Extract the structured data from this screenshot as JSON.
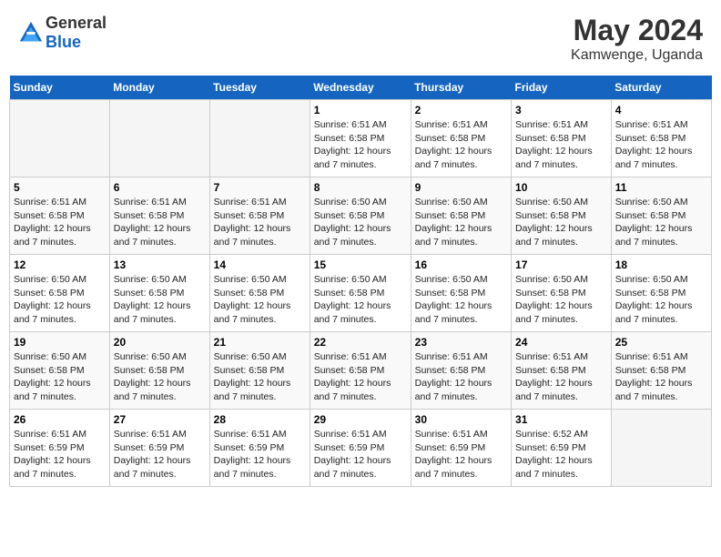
{
  "header": {
    "logo_general": "General",
    "logo_blue": "Blue",
    "month_title": "May 2024",
    "location": "Kamwenge, Uganda"
  },
  "weekdays": [
    "Sunday",
    "Monday",
    "Tuesday",
    "Wednesday",
    "Thursday",
    "Friday",
    "Saturday"
  ],
  "weeks": [
    [
      {
        "day": "",
        "sunrise": "",
        "sunset": "",
        "daylight": ""
      },
      {
        "day": "",
        "sunrise": "",
        "sunset": "",
        "daylight": ""
      },
      {
        "day": "",
        "sunrise": "",
        "sunset": "",
        "daylight": ""
      },
      {
        "day": "1",
        "sunrise": "Sunrise: 6:51 AM",
        "sunset": "Sunset: 6:58 PM",
        "daylight": "Daylight: 12 hours and 7 minutes."
      },
      {
        "day": "2",
        "sunrise": "Sunrise: 6:51 AM",
        "sunset": "Sunset: 6:58 PM",
        "daylight": "Daylight: 12 hours and 7 minutes."
      },
      {
        "day": "3",
        "sunrise": "Sunrise: 6:51 AM",
        "sunset": "Sunset: 6:58 PM",
        "daylight": "Daylight: 12 hours and 7 minutes."
      },
      {
        "day": "4",
        "sunrise": "Sunrise: 6:51 AM",
        "sunset": "Sunset: 6:58 PM",
        "daylight": "Daylight: 12 hours and 7 minutes."
      }
    ],
    [
      {
        "day": "5",
        "sunrise": "Sunrise: 6:51 AM",
        "sunset": "Sunset: 6:58 PM",
        "daylight": "Daylight: 12 hours and 7 minutes."
      },
      {
        "day": "6",
        "sunrise": "Sunrise: 6:51 AM",
        "sunset": "Sunset: 6:58 PM",
        "daylight": "Daylight: 12 hours and 7 minutes."
      },
      {
        "day": "7",
        "sunrise": "Sunrise: 6:51 AM",
        "sunset": "Sunset: 6:58 PM",
        "daylight": "Daylight: 12 hours and 7 minutes."
      },
      {
        "day": "8",
        "sunrise": "Sunrise: 6:50 AM",
        "sunset": "Sunset: 6:58 PM",
        "daylight": "Daylight: 12 hours and 7 minutes."
      },
      {
        "day": "9",
        "sunrise": "Sunrise: 6:50 AM",
        "sunset": "Sunset: 6:58 PM",
        "daylight": "Daylight: 12 hours and 7 minutes."
      },
      {
        "day": "10",
        "sunrise": "Sunrise: 6:50 AM",
        "sunset": "Sunset: 6:58 PM",
        "daylight": "Daylight: 12 hours and 7 minutes."
      },
      {
        "day": "11",
        "sunrise": "Sunrise: 6:50 AM",
        "sunset": "Sunset: 6:58 PM",
        "daylight": "Daylight: 12 hours and 7 minutes."
      }
    ],
    [
      {
        "day": "12",
        "sunrise": "Sunrise: 6:50 AM",
        "sunset": "Sunset: 6:58 PM",
        "daylight": "Daylight: 12 hours and 7 minutes."
      },
      {
        "day": "13",
        "sunrise": "Sunrise: 6:50 AM",
        "sunset": "Sunset: 6:58 PM",
        "daylight": "Daylight: 12 hours and 7 minutes."
      },
      {
        "day": "14",
        "sunrise": "Sunrise: 6:50 AM",
        "sunset": "Sunset: 6:58 PM",
        "daylight": "Daylight: 12 hours and 7 minutes."
      },
      {
        "day": "15",
        "sunrise": "Sunrise: 6:50 AM",
        "sunset": "Sunset: 6:58 PM",
        "daylight": "Daylight: 12 hours and 7 minutes."
      },
      {
        "day": "16",
        "sunrise": "Sunrise: 6:50 AM",
        "sunset": "Sunset: 6:58 PM",
        "daylight": "Daylight: 12 hours and 7 minutes."
      },
      {
        "day": "17",
        "sunrise": "Sunrise: 6:50 AM",
        "sunset": "Sunset: 6:58 PM",
        "daylight": "Daylight: 12 hours and 7 minutes."
      },
      {
        "day": "18",
        "sunrise": "Sunrise: 6:50 AM",
        "sunset": "Sunset: 6:58 PM",
        "daylight": "Daylight: 12 hours and 7 minutes."
      }
    ],
    [
      {
        "day": "19",
        "sunrise": "Sunrise: 6:50 AM",
        "sunset": "Sunset: 6:58 PM",
        "daylight": "Daylight: 12 hours and 7 minutes."
      },
      {
        "day": "20",
        "sunrise": "Sunrise: 6:50 AM",
        "sunset": "Sunset: 6:58 PM",
        "daylight": "Daylight: 12 hours and 7 minutes."
      },
      {
        "day": "21",
        "sunrise": "Sunrise: 6:50 AM",
        "sunset": "Sunset: 6:58 PM",
        "daylight": "Daylight: 12 hours and 7 minutes."
      },
      {
        "day": "22",
        "sunrise": "Sunrise: 6:51 AM",
        "sunset": "Sunset: 6:58 PM",
        "daylight": "Daylight: 12 hours and 7 minutes."
      },
      {
        "day": "23",
        "sunrise": "Sunrise: 6:51 AM",
        "sunset": "Sunset: 6:58 PM",
        "daylight": "Daylight: 12 hours and 7 minutes."
      },
      {
        "day": "24",
        "sunrise": "Sunrise: 6:51 AM",
        "sunset": "Sunset: 6:58 PM",
        "daylight": "Daylight: 12 hours and 7 minutes."
      },
      {
        "day": "25",
        "sunrise": "Sunrise: 6:51 AM",
        "sunset": "Sunset: 6:58 PM",
        "daylight": "Daylight: 12 hours and 7 minutes."
      }
    ],
    [
      {
        "day": "26",
        "sunrise": "Sunrise: 6:51 AM",
        "sunset": "Sunset: 6:59 PM",
        "daylight": "Daylight: 12 hours and 7 minutes."
      },
      {
        "day": "27",
        "sunrise": "Sunrise: 6:51 AM",
        "sunset": "Sunset: 6:59 PM",
        "daylight": "Daylight: 12 hours and 7 minutes."
      },
      {
        "day": "28",
        "sunrise": "Sunrise: 6:51 AM",
        "sunset": "Sunset: 6:59 PM",
        "daylight": "Daylight: 12 hours and 7 minutes."
      },
      {
        "day": "29",
        "sunrise": "Sunrise: 6:51 AM",
        "sunset": "Sunset: 6:59 PM",
        "daylight": "Daylight: 12 hours and 7 minutes."
      },
      {
        "day": "30",
        "sunrise": "Sunrise: 6:51 AM",
        "sunset": "Sunset: 6:59 PM",
        "daylight": "Daylight: 12 hours and 7 minutes."
      },
      {
        "day": "31",
        "sunrise": "Sunrise: 6:52 AM",
        "sunset": "Sunset: 6:59 PM",
        "daylight": "Daylight: 12 hours and 7 minutes."
      },
      {
        "day": "",
        "sunrise": "",
        "sunset": "",
        "daylight": ""
      }
    ]
  ]
}
